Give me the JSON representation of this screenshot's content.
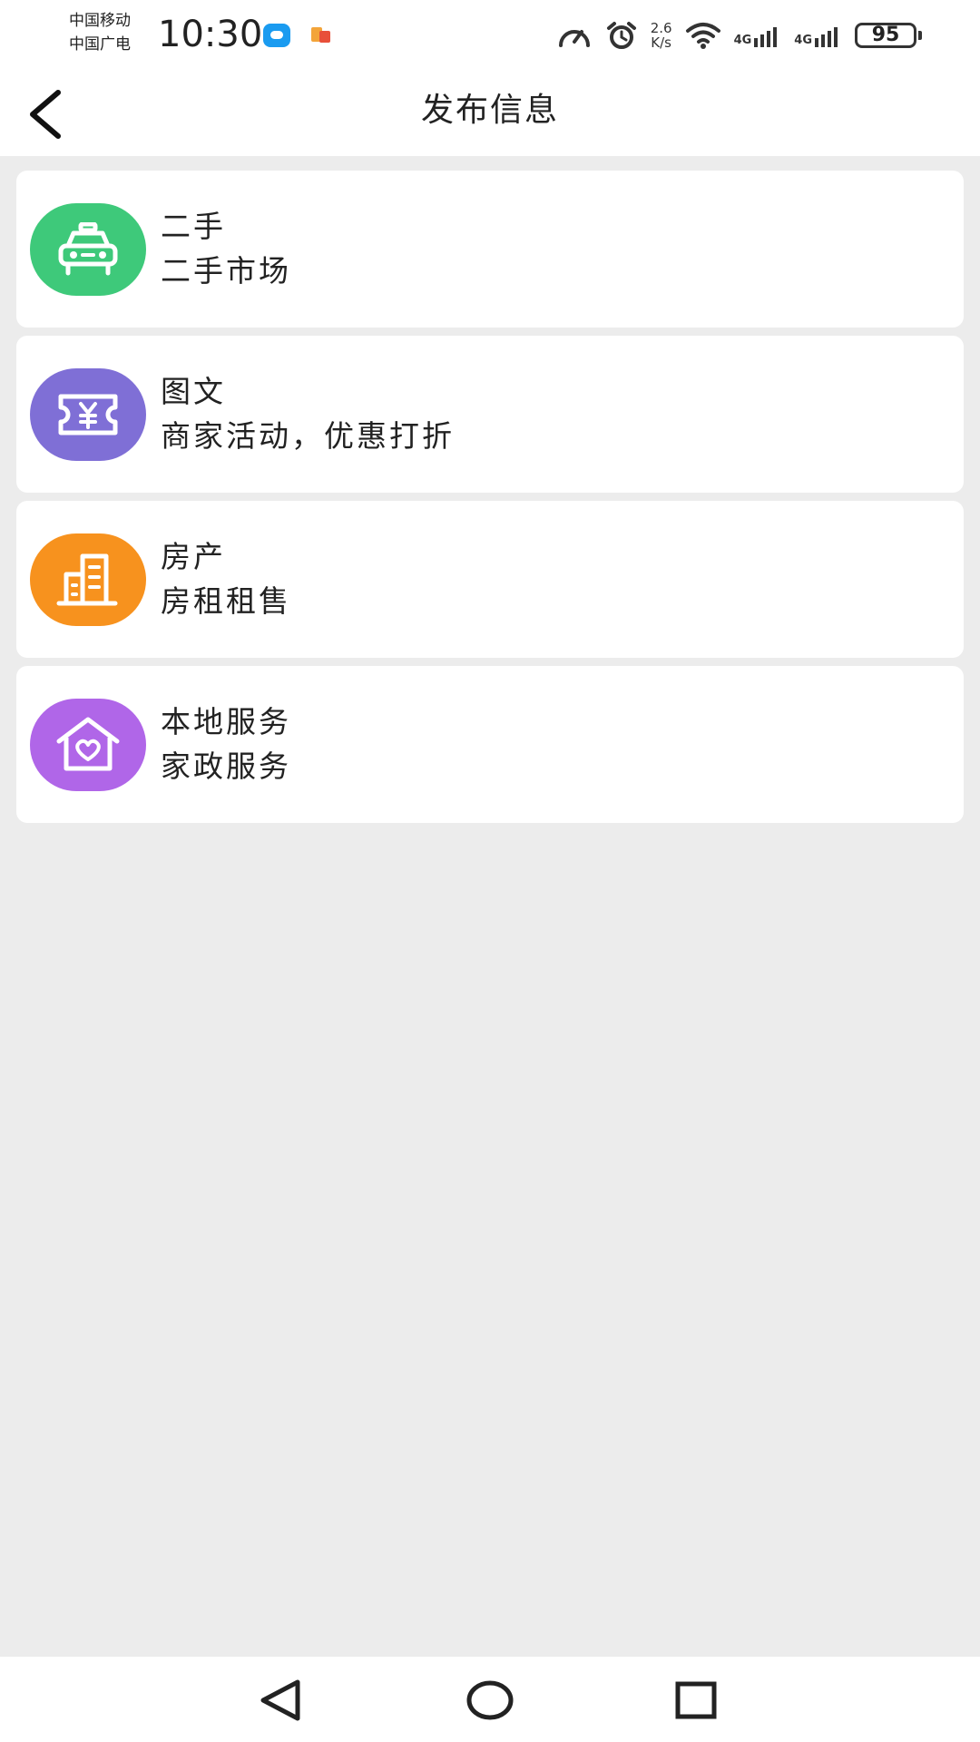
{
  "status_bar": {
    "carrier_1": "中国移动",
    "carrier_2": "中国广电",
    "time": "10:30",
    "net_speed_value": "2.6",
    "net_speed_unit": "K/s",
    "network_1": "4G",
    "network_2": "4G",
    "battery": "95"
  },
  "header": {
    "title": "发布信息"
  },
  "categories": [
    {
      "title": "二手",
      "subtitle": "二手市场",
      "icon": "car-icon",
      "color": "#3ec97a"
    },
    {
      "title": "图文",
      "subtitle": "商家活动，优惠打折",
      "icon": "coupon-icon",
      "color": "#7f6fd6"
    },
    {
      "title": "房产",
      "subtitle": "房租租售",
      "icon": "building-icon",
      "color": "#f7921e"
    },
    {
      "title": "本地服务",
      "subtitle": "家政服务",
      "icon": "home-heart-icon",
      "color": "#b066e8"
    }
  ]
}
